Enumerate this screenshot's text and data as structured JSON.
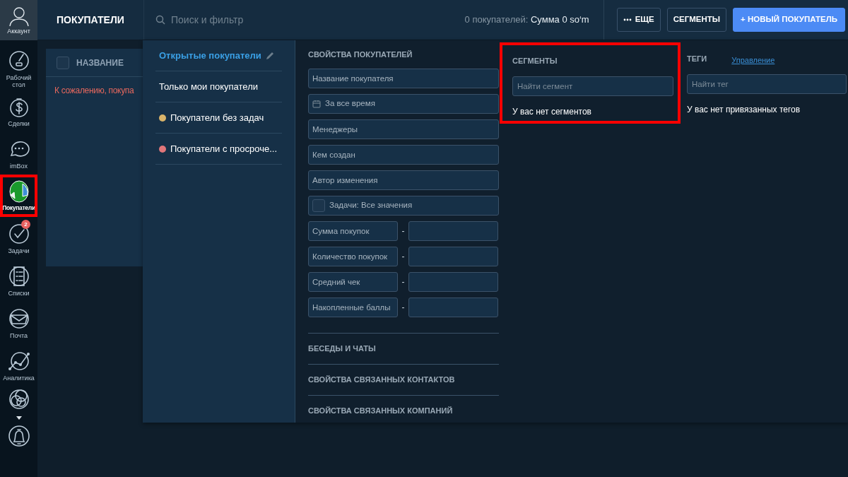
{
  "sidebar": {
    "account": {
      "label": "Аккаунт"
    },
    "items": [
      {
        "label": "Рабочий стол",
        "selected": false,
        "highlighted": false
      },
      {
        "label": "Сделки",
        "selected": false,
        "highlighted": false
      },
      {
        "label": "imBox",
        "selected": false,
        "highlighted": false
      },
      {
        "label": "Покупатели",
        "selected": true,
        "highlighted": true
      },
      {
        "label": "Задачи",
        "badge": "2",
        "selected": false,
        "highlighted": false
      },
      {
        "label": "Списки",
        "selected": false,
        "highlighted": false
      },
      {
        "label": "Почта",
        "selected": false,
        "highlighted": false
      },
      {
        "label": "Аналитика",
        "selected": false,
        "highlighted": false
      },
      {
        "selected": false,
        "highlighted": false,
        "expandable": true
      },
      {
        "selected": false,
        "highlighted": false
      }
    ]
  },
  "header": {
    "title": "ПОКУПАТЕЛИ",
    "search_placeholder": "Поиск и фильтр",
    "summary_label": "0 покупателей:",
    "summary_value": "Сумма 0 so‘m",
    "buttons": [
      {
        "kind": "more",
        "label": "ЕЩЕ"
      },
      {
        "kind": "outline",
        "label": "СЕГМЕНТЫ"
      },
      {
        "kind": "primary",
        "label": "+ НОВЫЙ ПОКУПАТЕЛЬ"
      }
    ]
  },
  "list": {
    "select_all_checked": false,
    "column": "НАЗВАНИЕ",
    "empty_message": "К сожалению, покупа"
  },
  "filter": {
    "presets": [
      {
        "label": "Открытые покупатели",
        "selected": true,
        "editable": true
      },
      {
        "label": "Только мои покупатели",
        "selected": false
      },
      {
        "label": "Покупатели без задач",
        "selected": false,
        "color": "#d9b46a"
      },
      {
        "label": "Покупатели с просроче...",
        "selected": false,
        "color": "#e0767a"
      }
    ],
    "properties": {
      "title": "СВОЙСТВА ПОКУПАТЕЛЕЙ",
      "fields": [
        {
          "kind": "text",
          "placeholder": "Название покупателя"
        },
        {
          "kind": "date",
          "value": "За все время"
        },
        {
          "kind": "text",
          "placeholder": "Менеджеры"
        },
        {
          "kind": "text",
          "placeholder": "Кем создан"
        },
        {
          "kind": "text",
          "placeholder": "Автор изменения"
        },
        {
          "kind": "checkbox",
          "label": "Задачи: Все значения",
          "checked": false
        },
        {
          "kind": "range",
          "placeholder": "Сумма покупок",
          "separator": "-"
        },
        {
          "kind": "range",
          "placeholder": "Количество покупок",
          "separator": "-"
        },
        {
          "kind": "range",
          "placeholder": "Средний чек",
          "separator": "-"
        },
        {
          "kind": "range",
          "placeholder": "Накопленные баллы",
          "separator": "-"
        }
      ]
    },
    "sections": [
      "БЕСЕДЫ И ЧАТЫ",
      "СВОЙСТВА СВЯЗАННЫХ КОНТАКТОВ",
      "СВОЙСТВА СВЯЗАННЫХ КОМПАНИЙ"
    ],
    "segments": {
      "title": "СЕГМЕНТЫ",
      "placeholder": "Найти сегмент",
      "empty_message": "У вас нет сегментов",
      "highlighted": true
    },
    "tags": {
      "title": "ТЕГИ",
      "link": "Управление",
      "placeholder": "Найти тег",
      "empty_message": "У вас нет привязанных тегов"
    }
  }
}
